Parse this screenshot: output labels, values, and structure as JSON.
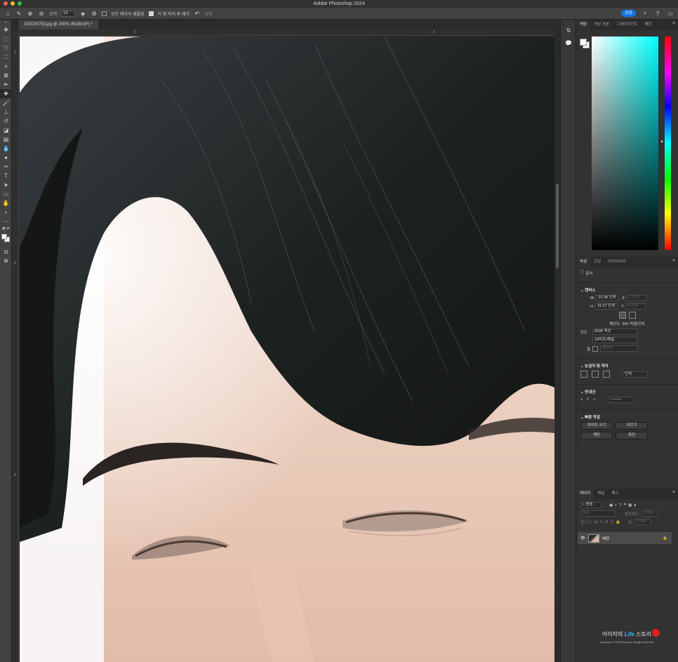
{
  "app": {
    "title": "Adobe Photoshop 2024",
    "traffic_lights": [
      "#ff5f57",
      "#febc2e",
      "#28c840"
    ]
  },
  "options_bar": {
    "size_label": "크기",
    "size_value": "19",
    "sample_all_layers": "모든 레이어 샘플링",
    "remove_after_stroke": "각 획 처리 후 제거",
    "diffusion": "방향",
    "share_label": "공유"
  },
  "document": {
    "tab_label": "DSC00753.jpg @ 200% (RGB/16*) *",
    "ruler_h": [
      "0",
      "5"
    ],
    "ruler_v": [
      "2",
      "3",
      "4"
    ]
  },
  "color_panel": {
    "tabs": [
      "색상",
      "색상 견본",
      "그레이디언트",
      "패턴"
    ],
    "active_tab": 0,
    "field_hue": "#00ffff"
  },
  "properties_panel": {
    "tabs": [
      "속성",
      "조정",
      "라이브러리"
    ],
    "doc_type": "문서",
    "canvas_title": "캔버스",
    "w_label": "W",
    "w_value": "23.38 인치",
    "h_label": "H",
    "h_value": "15.57 인치",
    "x_label": "X",
    "x_placeholder": "0 인치",
    "y_label": "Y",
    "y_placeholder": "0 인치",
    "resolution": "해상도: 300 픽셀/인치",
    "mode_label": "모드",
    "mode_value": "RGB 색상",
    "bit_value": "16비트/채널",
    "fill_label": "칠",
    "fill_value": "배경색",
    "rulers_title": "눈금자 및 격자",
    "unit_value": "인치",
    "guides_title": "안내선",
    "quick_actions_title": "빠른 작업",
    "btn_image_size": "이미지 크기",
    "btn_trim": "자르기",
    "btn_crop": "재단",
    "btn_rotate": "회전"
  },
  "layers_panel": {
    "tabs": [
      "레이어",
      "채널",
      "패스"
    ],
    "search_placeholder": "종류",
    "blend_mode": "표준",
    "opacity_label": "불투명도:",
    "opacity_value": "100%",
    "lock_label": "잠그기:",
    "fill_label": "칠:",
    "fill_value": "100%",
    "layer_name": "배경"
  },
  "watermark": {
    "line1_pre": "아이작의",
    "line1_life": "Life",
    "line1_post": "스토리",
    "line2": "copyright © 2023 by isaac all right reserved"
  }
}
